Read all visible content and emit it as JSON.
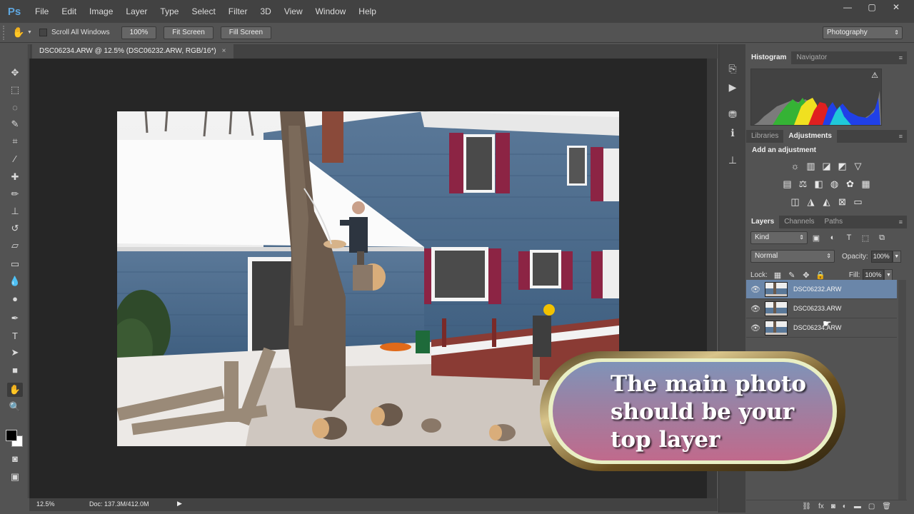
{
  "app": {
    "logo": "Ps"
  },
  "menu": [
    "File",
    "Edit",
    "Image",
    "Layer",
    "Type",
    "Select",
    "Filter",
    "3D",
    "View",
    "Window",
    "Help"
  ],
  "window_controls": {
    "minimize": "—",
    "restore": "▢",
    "close": "✕"
  },
  "options_bar": {
    "scroll_all_label": "Scroll All Windows",
    "zoom_btn": "100%",
    "fit_screen": "Fit Screen",
    "fill_screen": "Fill Screen",
    "workspace": "Photography"
  },
  "document": {
    "tab_title": "DSC06234.ARW @ 12.5% (DSC06232.ARW, RGB/16*)",
    "close": "×"
  },
  "status": {
    "zoom": "12.5%",
    "doc_size": "Doc: 137.3M/412.0M"
  },
  "panels": {
    "histogram_tabs": [
      "Histogram",
      "Navigator"
    ],
    "adjust_tabs": [
      "Libraries",
      "Adjustments"
    ],
    "add_adjustment": "Add an adjustment",
    "layers_tabs": [
      "Layers",
      "Channels",
      "Paths"
    ],
    "kind": "Kind",
    "blend_mode": "Normal",
    "opacity_label": "Opacity:",
    "opacity": "100%",
    "lock_label": "Lock:",
    "fill_label": "Fill:",
    "fill": "100%"
  },
  "layers": [
    {
      "name": "DSC06232.ARW",
      "selected": true
    },
    {
      "name": "DSC06233.ARW",
      "selected": false
    },
    {
      "name": "DSC06234.ARW",
      "selected": false
    }
  ],
  "callout": {
    "line1": "The main photo",
    "line2": "should be your",
    "line3": "top layer"
  },
  "colors": {
    "accent_blue": "#5fa7e0",
    "selected_layer": "#6a86a9",
    "house_siding": "#4a6a8a",
    "shutter": "#8c2444"
  }
}
